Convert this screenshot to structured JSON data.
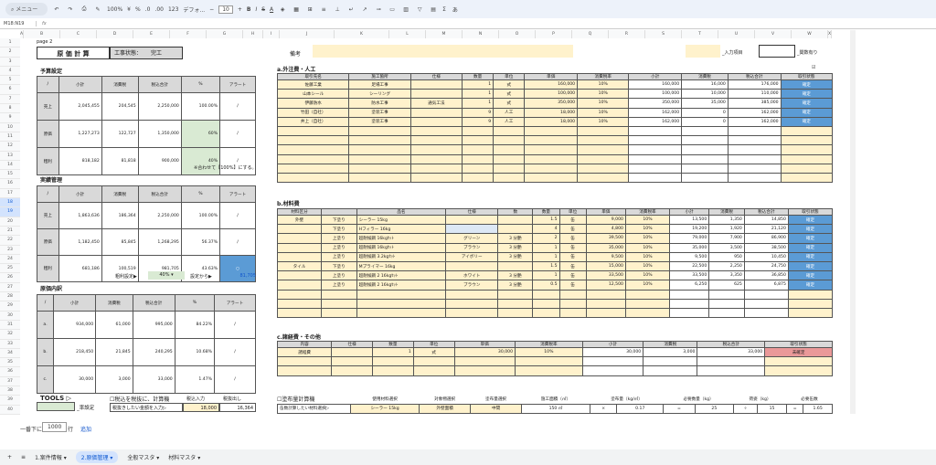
{
  "toolbar": {
    "search": "メニュー",
    "zoom": "100%",
    "currency": "¥",
    "percent": "%",
    "dec1": ".0",
    "dec2": ".00",
    "numfmt": "123",
    "font": "デフォ...",
    "minus": "−",
    "size": "10",
    "plus": "+",
    "bold": "B",
    "italic": "I",
    "strike": "S",
    "textcolor": "A",
    "sum": "Σ"
  },
  "formula": {
    "namebox": "M18:N19",
    "fx": "fx"
  },
  "columns": [
    [
      "",
      "A"
    ],
    [
      "",
      "B"
    ],
    [
      "",
      "C"
    ],
    [
      "",
      "D"
    ],
    [
      "",
      "E"
    ],
    [
      "",
      "F"
    ],
    [
      "",
      "G"
    ],
    [
      "",
      "H"
    ],
    [
      "",
      "I"
    ],
    [
      "",
      "J"
    ],
    [
      "",
      "K"
    ],
    [
      "",
      "L"
    ],
    [
      "",
      "M"
    ],
    [
      "",
      "N"
    ],
    [
      "",
      "O"
    ],
    [
      "",
      "P"
    ],
    [
      "",
      "Q"
    ],
    [
      "",
      "R"
    ],
    [
      "",
      "S"
    ],
    [
      "",
      "T"
    ],
    [
      "",
      "U"
    ],
    [
      "",
      "V"
    ],
    [
      "",
      "W"
    ],
    [
      "",
      "X"
    ]
  ],
  "colwidths": [
    4,
    40,
    40,
    40,
    40,
    40,
    40,
    22,
    18,
    60,
    60,
    40,
    40,
    40,
    40,
    40,
    40,
    40,
    40,
    40,
    40,
    40,
    40,
    4
  ],
  "rows": [
    "1",
    "2",
    "3",
    "4",
    "5",
    "6",
    "7",
    "8",
    "9",
    "10",
    "11",
    "12",
    "13",
    "14",
    "15",
    "16",
    "17",
    "18",
    "19",
    "20",
    "21",
    "22",
    "23",
    "24",
    "25",
    "26",
    "27",
    "28",
    "29",
    "30",
    "31",
    "32",
    "33",
    "34",
    "35",
    "36",
    "37",
    "38",
    "39",
    "40"
  ],
  "page_label": "page 2",
  "title": "原 価 計 算",
  "status_label": "工事状態：",
  "status_value": "完工",
  "note_label": "備考",
  "input_legend": "_入力項目",
  "fn_legend": "_関数有り",
  "budget": {
    "heading": "予算設定",
    "headers": [
      "/",
      "小計",
      "消費税",
      "税込合計",
      "%",
      "アラート"
    ],
    "rows": [
      [
        "売上",
        "2,045,455",
        "204,545",
        "2,250,000",
        "100.00%",
        "/"
      ],
      [
        "原価",
        "1,227,273",
        "122,727",
        "1,350,000",
        "60%",
        "/"
      ],
      [
        "粗利",
        "818,182",
        "81,818",
        "900,000",
        "40%",
        "/"
      ]
    ],
    "note": "※合わせて【100%】にする。"
  },
  "actual": {
    "heading": "実績管理",
    "headers": [
      "/",
      "小計",
      "消費税",
      "税込合計",
      "%",
      "アラート"
    ],
    "rows": [
      [
        "売上",
        "1,863,636",
        "186,364",
        "2,250,000",
        "100.00%",
        "/"
      ],
      [
        "原価",
        "1,182,450",
        "85,845",
        "1,268,295",
        "56.37%",
        "/"
      ],
      [
        "粗利",
        "681,186",
        "100,519",
        "981,705",
        "43.63%",
        "○"
      ]
    ],
    "target_label": "粗利設定▶",
    "target_value": "40%",
    "from_label": "設定から▶",
    "from_value": "81,705"
  },
  "breakdown": {
    "heading": "原価内訳",
    "headers": [
      "/",
      "小計",
      "消費税",
      "税込合計",
      "%",
      "アラート"
    ],
    "rows": [
      [
        "a.",
        "934,000",
        "61,000",
        "995,000",
        "84.22%",
        "/"
      ],
      [
        "b.",
        "218,450",
        "21,845",
        "240,295",
        "10.68%",
        "/"
      ],
      [
        "c.",
        "30,000",
        "3,000",
        "33,000",
        "1.47%",
        "/"
      ]
    ]
  },
  "tools": {
    "heading": "TOOLS ▷",
    "rate_label": "_率設定",
    "tax_check": "☐税込を税抜に、計算機",
    "tax_in_label": "税込入力",
    "tax_out_label": "税抜出し",
    "tax_prompt": "税抜きしたい金額を入力▷",
    "tax_in": "18,000",
    "tax_out": "16,364",
    "paint_check": "☐塗布量計算機",
    "paint_prompt": "缶数計算したい材料選択▷",
    "paint_headers": [
      "使用材料選択",
      "対象物選択",
      "塗布量選択",
      "施工面積（㎡）",
      "塗布量（kg/㎡）",
      "必要数量（kg）",
      "荷姿（kg）",
      "必要缶数"
    ],
    "paint_values": [
      "シーラー 15kg",
      "外壁面積",
      "中間",
      "150 ㎡",
      "×",
      "0.17",
      "=",
      "25",
      "÷",
      "15",
      "=",
      "1.65"
    ]
  },
  "outsource": {
    "heading": "a.外注費・人工",
    "check": "☑",
    "headers": [
      "取引先名",
      "施工箇所",
      "仕様",
      "数量",
      "単位",
      "単価",
      "消費税率",
      "小計",
      "消費税",
      "税込合計",
      "取引状態"
    ],
    "rows": [
      [
        "佐藤工業",
        "足場工事",
        "",
        "1",
        "式",
        "160,000",
        "10%",
        "160,000",
        "16,000",
        "176,000",
        "確定"
      ],
      [
        "山本シール",
        "シーリング",
        "",
        "1",
        "式",
        "100,000",
        "10%",
        "100,000",
        "10,000",
        "110,000",
        "確定"
      ],
      [
        "伊藤防水",
        "防水工事",
        "通気工法",
        "1",
        "式",
        "350,000",
        "10%",
        "350,000",
        "35,000",
        "385,000",
        "確定"
      ],
      [
        "竹田（自社）",
        "塗装工事",
        "",
        "9",
        "人工",
        "18,000",
        "10%",
        "162,000",
        "0",
        "162,000",
        "確定"
      ],
      [
        "井上（自社）",
        "塗装工事",
        "",
        "9",
        "人工",
        "18,000",
        "10%",
        "162,000",
        "0",
        "162,000",
        "確定"
      ]
    ]
  },
  "materials": {
    "heading": "b.材料費",
    "headers": [
      "材料区分",
      "",
      "品名",
      "仕様",
      "数",
      "数量",
      "単位",
      "単価",
      "消費税率",
      "小計",
      "消費税",
      "税込合計",
      "取引状態"
    ],
    "rows": [
      [
        "外壁",
        "下塗り",
        "シーラー 15kg",
        "",
        "",
        "1.5",
        "缶",
        "9,000",
        "10%",
        "13,500",
        "1,350",
        "14,850",
        "確定"
      ],
      [
        "",
        "下塗り",
        "Hフィラー 16kg",
        "",
        "",
        "4",
        "缶",
        "4,800",
        "10%",
        "19,200",
        "1,920",
        "21,120",
        "確定"
      ],
      [
        "",
        "上塗り",
        "超耐候鋼 16kgｾｯﾄ",
        "グリーン",
        "3 分艶",
        "2",
        "缶",
        "39,500",
        "10%",
        "79,000",
        "7,900",
        "86,900",
        "確定"
      ],
      [
        "",
        "上塗り",
        "超耐候鋼 16kgｾｯﾄ",
        "ブラウン",
        "3 分艶",
        "1",
        "缶",
        "35,000",
        "10%",
        "35,000",
        "3,500",
        "38,500",
        "確定"
      ],
      [
        "",
        "上塗り",
        "超耐候鋼 3.2kgｾｯﾄ",
        "アイボリー",
        "3 分艶",
        "1",
        "缶",
        "9,500",
        "10%",
        "9,500",
        "950",
        "10,450",
        "確定"
      ],
      [
        "タイル",
        "下塗り",
        "Mプライマー 16kg",
        "",
        "",
        "1.5",
        "缶",
        "15,000",
        "10%",
        "22,500",
        "2,250",
        "24,750",
        "確定"
      ],
      [
        "",
        "上塗り",
        "超耐候鋼 2 16kgｾｯﾄ",
        "ホワイト",
        "3 分艶",
        "1",
        "缶",
        "33,500",
        "10%",
        "33,500",
        "3,350",
        "36,850",
        "確定"
      ],
      [
        "",
        "上塗り",
        "超耐候鋼 2 16kgｾｯﾄ",
        "ブラウン",
        "3 分艶",
        "0.5",
        "缶",
        "12,500",
        "10%",
        "6,250",
        "625",
        "6,875",
        "確定"
      ]
    ]
  },
  "misc": {
    "heading": "c.諸経費・その他",
    "headers": [
      "内容",
      "仕様",
      "数量",
      "単位",
      "単価",
      "消費税率",
      "小計",
      "消費税",
      "税込合計",
      "取引状態"
    ],
    "rows": [
      [
        "諸経費",
        "",
        "1",
        "式",
        "30,000",
        "10%",
        "30,000",
        "3,000",
        "33,000",
        "未確定"
      ]
    ]
  },
  "bottom": {
    "prefix": "一番下に",
    "count": "1000",
    "unit": "行",
    "add": "追加"
  },
  "tabs": [
    "+",
    "≡",
    "1.案件情報 ▾",
    "2.原価管理 ▾",
    "全般マスタ ▾",
    "材料マスタ ▾"
  ],
  "colors": {
    "yellow": "#fff2cc",
    "green": "#d9ead3",
    "blue": "#5b9bd5",
    "pink": "#ea9999"
  }
}
